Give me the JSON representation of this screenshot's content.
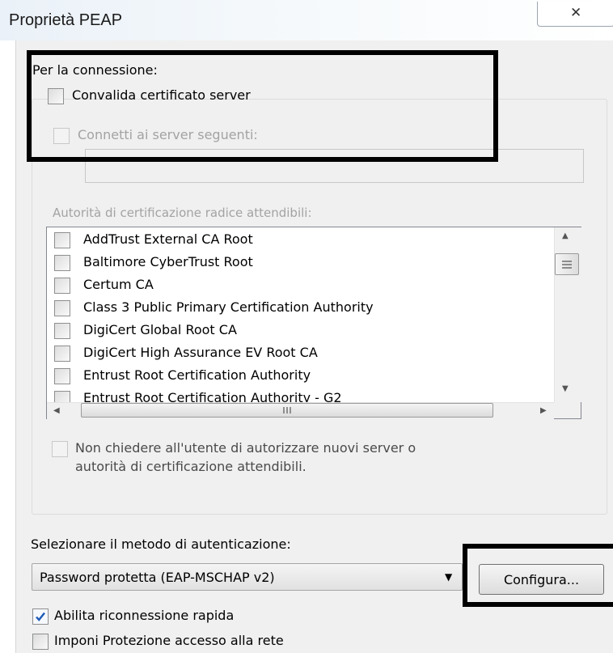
{
  "window": {
    "title": "Proprietà PEAP",
    "close_glyph": "✕"
  },
  "connection": {
    "heading": "Per la connessione:",
    "validate_cert": {
      "label": "Convalida certificato server",
      "checked": false
    },
    "connect_servers": {
      "label": "Connetti ai server seguenti:",
      "checked": false,
      "value": ""
    }
  },
  "trusted_ca": {
    "label": "Autorità di certificazione radice attendibili:",
    "items": [
      {
        "label": "AddTrust External CA Root",
        "checked": false
      },
      {
        "label": "Baltimore CyberTrust Root",
        "checked": false
      },
      {
        "label": "Certum CA",
        "checked": false
      },
      {
        "label": "Class 3 Public Primary Certification Authority",
        "checked": false
      },
      {
        "label": "DigiCert Global Root CA",
        "checked": false
      },
      {
        "label": "DigiCert High Assurance EV Root CA",
        "checked": false
      },
      {
        "label": "Entrust Root Certification Authority",
        "checked": false
      },
      {
        "label": "Entrust Root Certification Authority - G2",
        "checked": false
      }
    ]
  },
  "prompt_option": {
    "line1": "Non chiedere all'utente di autorizzare nuovi server o",
    "line2": "autorità di certificazione attendibili.",
    "checked": false
  },
  "auth": {
    "label": "Selezionare il metodo di autenticazione:",
    "selected": "Password protetta (EAP-MSCHAP v2)",
    "configure_label": "Configura..."
  },
  "options": {
    "fast_reconnect": {
      "label": "Abilita riconnessione rapida",
      "checked": true
    },
    "nap": {
      "label": "Imponi Protezione accesso alla rete",
      "checked": false
    }
  },
  "colors": {
    "highlight": "#000000",
    "check": "#1e5bb8",
    "disabled_text": "#a3a3a3"
  },
  "icons": {
    "close": "close-icon",
    "checkbox": "checkbox-icon",
    "scroll_up": "scroll-up-icon",
    "scroll_down": "scroll-down-icon",
    "scroll_left": "scroll-left-icon",
    "scroll_right": "scroll-right-icon",
    "dropdown": "chevron-down-icon"
  }
}
